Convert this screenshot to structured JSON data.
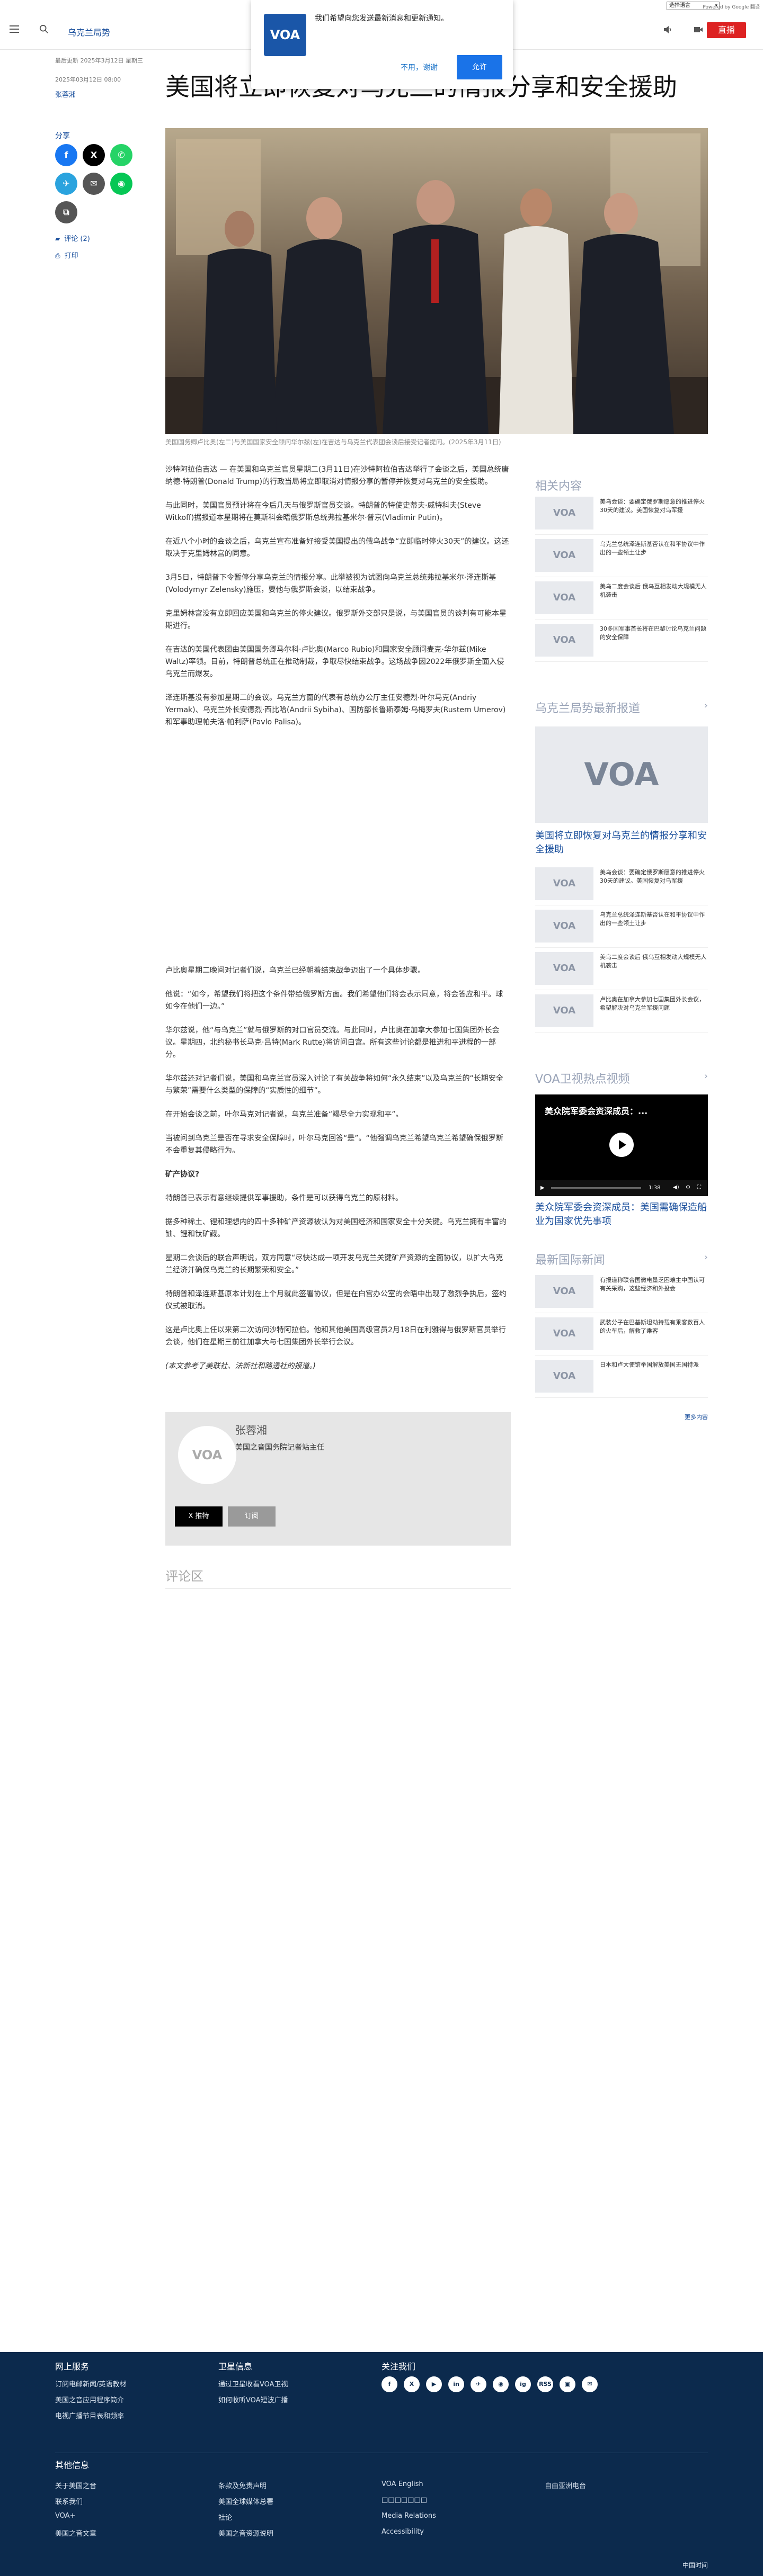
{
  "util": {
    "language_select": "选择语言",
    "powered_by": "Powered by Google 翻译"
  },
  "header": {
    "section": "乌克兰局势",
    "live": "直播"
  },
  "notification": {
    "message": "我们希望向您发送最新消息和更新通知。",
    "decline": "不用，谢谢",
    "accept": "允许",
    "logo": "VOA"
  },
  "article": {
    "updated": "最后更新 2025年3月12日 星期三",
    "date": "2025年03月12日 08:00",
    "author": "张蓉湘",
    "title": "美国将立即恢复对乌克兰的情报分享和安全援助",
    "share_label": "分享",
    "comments_link": "评论 (2)",
    "print_link": "打印",
    "hero_caption": "美国国务卿卢比奥(左二)与美国国家安全顾问华尔兹(左)在吉达与乌克兰代表团会谈后接受记者提问。(2025年3月11日)",
    "paragraphs": [
      "沙特阿拉伯吉达 — 在美国和乌克兰官员星期二(3月11日)在沙特阿拉伯吉达举行了会谈之后，美国总统唐纳德·特朗普(Donald Trump)的行政当局将立即取消对情报分享的暂停并恢复对乌克兰的安全援助。",
      "与此同时，美国官员预计将在今后几天与俄罗斯官员交谈。特朗普的特使史蒂夫·威特科夫(Steve Witkoff)据报道本星期将在莫斯科会晤俄罗斯总统弗拉基米尔·普京(Vladimir Putin)。",
      "在近八个小时的会谈之后，乌克兰宣布准备好接受美国提出的俄乌战争“立即临时停火30天”的建议。这还取决于克里姆林宫的同意。",
      "3月5日，特朗普下令暂停分享乌克兰的情报分享。此举被视为试图向乌克兰总统弗拉基米尔·泽连斯基(Volodymyr Zelensky)施压，要他与俄罗斯会谈，以结束战争。",
      "克里姆林宫没有立即回应美国和乌克兰的停火建议。俄罗斯外交部只是说，与美国官员的谈判有可能本星期进行。",
      "在吉达的美国代表团由美国国务卿马尔科·卢比奥(Marco Rubio)和国家安全顾问麦克·华尔兹(Mike Waltz)率领。目前，特朗普总统正在推动制裁，争取尽快结束战争。这场战争因2022年俄罗斯全面入侵乌克兰而爆发。",
      "泽连斯基没有参加星期二的会议。乌克兰方面的代表有总统办公厅主任安德烈·叶尔马克(Andriy Yermak)、乌克兰外长安德烈·西比哈(Andrii Sybiha)、国防部长鲁斯泰姆·乌梅罗夫(Rustem Umerov)和军事助理帕夫洛·帕利萨(Pavlo Palisa)。",
      "卢比奥星期二晚间对记者们说，乌克兰已经朝着结束战争迈出了一个具体步骤。",
      "他说：“如今，希望我们将把这个条件带给俄罗斯方面。我们希望他们将会表示同意，将会答应和平。球如今在他们一边。”",
      "华尔兹说，他“与乌克兰”就与俄罗斯的对口官员交流。与此同时，卢比奥在加拿大参加七国集团外长会议。星期四，北约秘书长马克·吕特(Mark Rutte)将访问白宫。所有这些讨论都是推进和平进程的一部分。",
      "华尔兹还对记者们说，美国和乌克兰官员深入讨论了有关战争将如何“永久结束”以及乌克兰的“长期安全与繁荣”需要什么类型的保障的“实质性的细节”。",
      "在开始会谈之前，叶尔马克对记者说，乌克兰准备“竭尽全力实现和平”。",
      "当被问到乌克兰是否在寻求安全保障时，叶尔马克回答“是”。“他强调乌克兰希望乌克兰希望确保俄罗斯不会重复其侵略行为。",
      "矿产协议?",
      "特朗普已表示有意继续提供军事援助，条件是可以获得乌克兰的原材料。",
      "据多种稀土、锂和理想内的四十多种矿产资源被认为对美国经济和国家安全十分关键。乌克兰拥有丰富的铀、锂和钛矿藏。",
      "星期二会谈后的联合声明说，双方同意“尽快达成一项开发乌克兰关键矿产资源的全面协议，以扩大乌克兰经济并确保乌克兰的长期繁荣和安全。”",
      "特朗普和泽连斯基原本计划在上个月就此签署协议，但是在白宫办公室的会晤中出现了激烈争执后，签约仪式被取消。",
      "这是卢比奥上任以来第二次访问沙特阿拉伯。他和其他美国高级官员2月18日在利雅得与俄罗斯官员举行会谈，他们在星期三前往加拿大与七国集团外长举行会议。",
      "(本文参考了美联社、法新社和路透社的报道。)"
    ]
  },
  "author_card": {
    "name": "张蓉湘",
    "title": "美国之音国务院记者站主任",
    "follow_x": "X 推特",
    "follow_rss": "订阅",
    "avatar": "VOA"
  },
  "comments_heading": "评论区",
  "sidebar": {
    "related_title": "相关内容",
    "related": [
      "美乌会谈：要确定俄罗斯愿意的推进停火30天的建议。美国恢复对乌军援",
      "乌克兰总统泽连斯基否认在和平协议中作出的一些领土让步",
      "美乌二度会谈后 俄乌互相发动大规模无人机袭击",
      "30多国军事首长将在巴黎讨论乌克兰问题的安全保障"
    ],
    "ukraine_title": "乌克兰局势最新报道",
    "ukraine_feature": "美国将立即恢复对乌克兰的情报分享和安全援助",
    "ukraine": [
      "美乌会谈：要确定俄罗斯愿意的推进停火30天的建议。美国恢复对乌军援",
      "乌克兰总统泽连斯基否认在和平协议中作出的一些领土让步",
      "美乌二度会谈后 俄乌互相发动大规模无人机袭击",
      "卢比奥在加拿大参加七国集团外长会议，希望解决对乌克兰军援问题"
    ],
    "video_title": "VOA卫视热点视频",
    "video_overlay": "美众院军委会资深成员：...",
    "video_time": "1:38",
    "video_caption": "美众院军委会资深成员：美国需确保造船业为国家优先事项",
    "intl_title": "最新国际新闻",
    "intl": [
      "有报道称联合国微电量乏困难主中国认可有关采购，这些经济和外投会",
      "武装分子在巴基斯坦劫持载有乘客数百人的火车后，解救了乘客",
      "日本和卢大使馆举国解放美国无国特派"
    ],
    "more": "更多内容"
  },
  "footer": {
    "col1_title": "网上服务",
    "col1": [
      "订阅电邮新闻/英语教材",
      "美国之音应用程序简介",
      "电视广播节目表和频率"
    ],
    "col2_title": "卫星信息",
    "col2": [
      "通过卫星收看VOA卫视",
      "如何收听VOA短波广播"
    ],
    "col3_title": "关注我们",
    "social": [
      "f",
      "X",
      "▶",
      "in",
      "✈",
      "◉",
      "ig",
      "RSS",
      "▣",
      "✉"
    ],
    "other_title": "其他信息",
    "links_a": [
      "关于美国之音",
      "联系我们",
      "VOA+",
      "美国之音文章"
    ],
    "links_b": [
      "条款及免责声明",
      "美国全球媒体总署",
      "社论",
      "美国之音资源说明"
    ],
    "links_c": [
      "VOA English",
      "□□□□□□□",
      "Media Relations",
      "Accessibility"
    ],
    "links_d": [
      "自由亚洲电台"
    ],
    "copyright": "中国时间"
  },
  "colors": {
    "brand_blue": "#1a4f9c",
    "live_red": "#dd2222",
    "footer_bg": "#0c2a4d"
  }
}
